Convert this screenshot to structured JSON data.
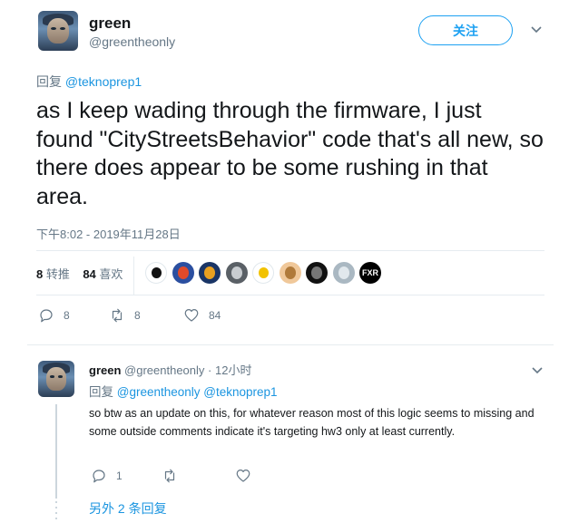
{
  "main_tweet": {
    "author_name": "green",
    "author_handle": "@greentheonly",
    "follow_label": "关注",
    "replying_prefix": "回复",
    "replying_to": "@teknoprep1",
    "text": "as I keep wading through the firmware, I just found \"CityStreetsBehavior\" code that's all new, so there does appear to be some rushing in that area.",
    "timestamp": "下午8:02 - 2019年11月28日",
    "retweets_count": "8",
    "retweets_label": "转推",
    "likes_count": "84",
    "likes_label": "喜欢",
    "liker_avatars": [
      {
        "name": "liker-avatar-1",
        "bg": "#ffffff",
        "fg": "#111111"
      },
      {
        "name": "liker-avatar-2",
        "bg": "#2b4fa0",
        "fg": "#e04a2a"
      },
      {
        "name": "liker-avatar-3",
        "bg": "#1a3566",
        "fg": "#e8a020"
      },
      {
        "name": "liker-avatar-4",
        "bg": "#5a6066",
        "fg": "#c8ccd0"
      },
      {
        "name": "liker-avatar-5",
        "bg": "#ffffff",
        "fg": "#f2c200"
      },
      {
        "name": "liker-avatar-6",
        "bg": "#f0c89a",
        "fg": "#b07a3a"
      },
      {
        "name": "liker-avatar-7",
        "bg": "#111111",
        "fg": "#777777"
      },
      {
        "name": "liker-avatar-8",
        "bg": "#aab8c2",
        "fg": "#e1e8ed"
      },
      {
        "name": "liker-avatar-9",
        "bg": "#000000",
        "fg": "#ffffff",
        "text": "FXR"
      }
    ],
    "reply_count": "8",
    "retweet_action_count": "8",
    "like_action_count": "84"
  },
  "reply_tweet": {
    "author_name": "green",
    "author_handle": "@greentheonly",
    "time_sep": "·",
    "time": "12小时",
    "replying_prefix": "回复",
    "replying_to_1": "@greentheonly",
    "replying_to_2": "@teknoprep1",
    "text": "so btw as an update on this, for whatever reason most of this logic seems to missing and some outside comments indicate it's targeting hw3 only at least currently.",
    "reply_count": "1"
  },
  "more_replies_label": "另外 2 条回复",
  "colors": {
    "accent": "#1da1f2",
    "link": "#1b95e0",
    "secondary_text": "#657786",
    "divider": "#e6ecf0"
  }
}
